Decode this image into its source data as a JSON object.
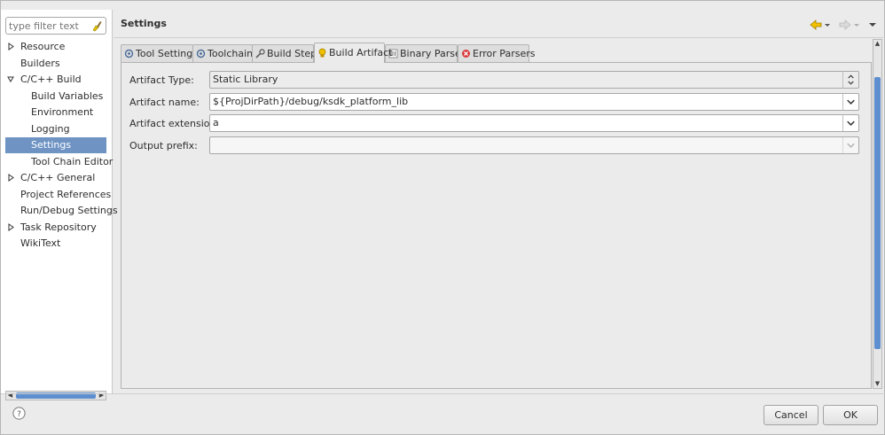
{
  "filter": {
    "placeholder": "type filter text"
  },
  "tree": {
    "items": [
      {
        "label": "Resource",
        "level": 0,
        "twisty": "collapsed"
      },
      {
        "label": "Builders",
        "level": 0,
        "twisty": "none"
      },
      {
        "label": "C/C++ Build",
        "level": 0,
        "twisty": "expanded"
      },
      {
        "label": "Build Variables",
        "level": 1,
        "twisty": "none"
      },
      {
        "label": "Environment",
        "level": 1,
        "twisty": "none"
      },
      {
        "label": "Logging",
        "level": 1,
        "twisty": "none"
      },
      {
        "label": "Settings",
        "level": 1,
        "twisty": "none",
        "selected": true
      },
      {
        "label": "Tool Chain Editor",
        "level": 1,
        "twisty": "none"
      },
      {
        "label": "C/C++ General",
        "level": 0,
        "twisty": "collapsed"
      },
      {
        "label": "Project References",
        "level": 0,
        "twisty": "none"
      },
      {
        "label": "Run/Debug Settings",
        "level": 0,
        "twisty": "none"
      },
      {
        "label": "Task Repository",
        "level": 0,
        "twisty": "collapsed"
      },
      {
        "label": "WikiText",
        "level": 0,
        "twisty": "none"
      }
    ]
  },
  "page": {
    "title": "Settings"
  },
  "tabs": [
    {
      "label": "Tool Settings",
      "icon": "tool-settings-icon"
    },
    {
      "label": "Toolchains",
      "icon": "toolchains-icon"
    },
    {
      "label": "Build Steps",
      "icon": "wrench-icon"
    },
    {
      "label": "Build Artifact",
      "icon": "artifact-icon",
      "active": true
    },
    {
      "label": "Binary Parsers",
      "icon": "binary-icon"
    },
    {
      "label": "Error Parsers",
      "icon": "error-icon"
    }
  ],
  "form": {
    "artifact_type_label": "Artifact Type:",
    "artifact_type_value": "Static Library",
    "artifact_name_label": "Artifact name:",
    "artifact_name_value": "${ProjDirPath}/debug/ksdk_platform_lib",
    "artifact_extension_label": "Artifact extension:",
    "artifact_extension_value": "a",
    "output_prefix_label": "Output prefix:",
    "output_prefix_value": ""
  },
  "buttons": {
    "cancel": "Cancel",
    "ok": "OK"
  },
  "colors": {
    "selection": "#6f94c4",
    "scroll_thumb": "#5d8ecf",
    "back_arrow": "#e0a800"
  }
}
